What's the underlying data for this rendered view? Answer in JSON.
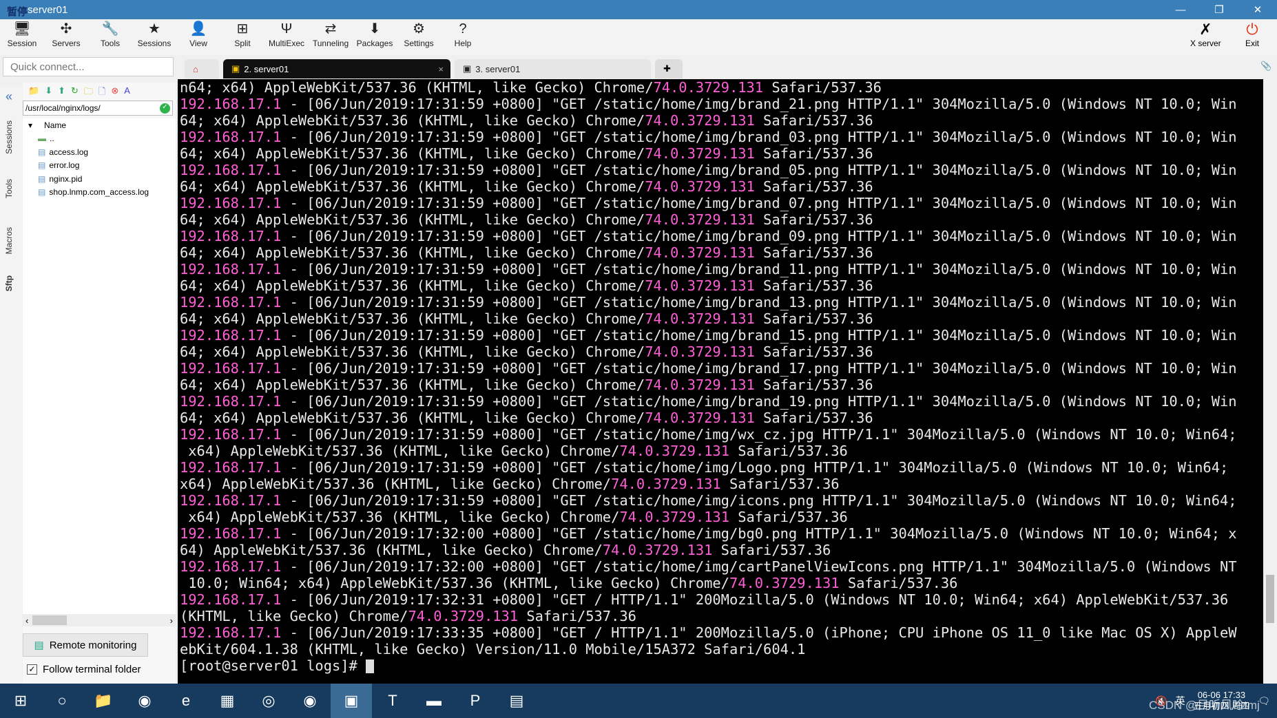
{
  "window": {
    "title": "server01",
    "overlay_label": "暂停",
    "minimize": "—",
    "restore": "❐",
    "close": "✕"
  },
  "toolbar": {
    "items": [
      {
        "label": "Session",
        "icon": "session-icon",
        "glyph": "🖥"
      },
      {
        "label": "Servers",
        "icon": "servers-icon",
        "glyph": "✣"
      },
      {
        "label": "Tools",
        "icon": "tools-icon",
        "glyph": "🔧"
      },
      {
        "label": "Sessions",
        "icon": "star-icon",
        "glyph": "★"
      },
      {
        "label": "View",
        "icon": "view-icon",
        "glyph": "👤"
      },
      {
        "label": "Split",
        "icon": "split-icon",
        "glyph": "⊞"
      },
      {
        "label": "MultiExec",
        "icon": "multiexec-icon",
        "glyph": "Ψ"
      },
      {
        "label": "Tunneling",
        "icon": "tunneling-icon",
        "glyph": "⇄"
      },
      {
        "label": "Packages",
        "icon": "packages-icon",
        "glyph": "⬇"
      },
      {
        "label": "Settings",
        "icon": "settings-icon",
        "glyph": "⚙"
      },
      {
        "label": "Help",
        "icon": "help-icon",
        "glyph": "?"
      }
    ],
    "xserver": "X server",
    "exit": "Exit"
  },
  "quick_connect": {
    "placeholder": "Quick connect..."
  },
  "tabs": [
    {
      "label": "2. server01",
      "active": true,
      "close": "×"
    },
    {
      "label": "3. server01",
      "active": false
    }
  ],
  "side_tabs": [
    "Sessions",
    "Tools",
    "Macros",
    "Sftp"
  ],
  "sftp": {
    "path": "/usr/local/nginx/logs/",
    "column": "Name",
    "files": [
      "..",
      "access.log",
      "error.log",
      "nginx.pid",
      "shop.lnmp.com_access.log"
    ],
    "remote_monitoring": "Remote monitoring",
    "follow_terminal": "Follow terminal folder",
    "follow_checked": true
  },
  "terminal": {
    "highlight_color": "#ff5fd7",
    "lines": [
      "n64; x64) AppleWebKit/537.36 (KHTML, like Gecko) Chrome/74.0.3729.131 Safari/537.36",
      "192.168.17.1 - [06/Jun/2019:17:31:59 +0800] \"GET /static/home/img/brand_21.png HTTP/1.1\" 304Mozilla/5.0 (Windows NT 10.0; Win",
      "64; x64) AppleWebKit/537.36 (KHTML, like Gecko) Chrome/74.0.3729.131 Safari/537.36",
      "192.168.17.1 - [06/Jun/2019:17:31:59 +0800] \"GET /static/home/img/brand_03.png HTTP/1.1\" 304Mozilla/5.0 (Windows NT 10.0; Win",
      "64; x64) AppleWebKit/537.36 (KHTML, like Gecko) Chrome/74.0.3729.131 Safari/537.36",
      "192.168.17.1 - [06/Jun/2019:17:31:59 +0800] \"GET /static/home/img/brand_05.png HTTP/1.1\" 304Mozilla/5.0 (Windows NT 10.0; Win",
      "64; x64) AppleWebKit/537.36 (KHTML, like Gecko) Chrome/74.0.3729.131 Safari/537.36",
      "192.168.17.1 - [06/Jun/2019:17:31:59 +0800] \"GET /static/home/img/brand_07.png HTTP/1.1\" 304Mozilla/5.0 (Windows NT 10.0; Win",
      "64; x64) AppleWebKit/537.36 (KHTML, like Gecko) Chrome/74.0.3729.131 Safari/537.36",
      "192.168.17.1 - [06/Jun/2019:17:31:59 +0800] \"GET /static/home/img/brand_09.png HTTP/1.1\" 304Mozilla/5.0 (Windows NT 10.0; Win",
      "64; x64) AppleWebKit/537.36 (KHTML, like Gecko) Chrome/74.0.3729.131 Safari/537.36",
      "192.168.17.1 - [06/Jun/2019:17:31:59 +0800] \"GET /static/home/img/brand_11.png HTTP/1.1\" 304Mozilla/5.0 (Windows NT 10.0; Win",
      "64; x64) AppleWebKit/537.36 (KHTML, like Gecko) Chrome/74.0.3729.131 Safari/537.36",
      "192.168.17.1 - [06/Jun/2019:17:31:59 +0800] \"GET /static/home/img/brand_13.png HTTP/1.1\" 304Mozilla/5.0 (Windows NT 10.0; Win",
      "64; x64) AppleWebKit/537.36 (KHTML, like Gecko) Chrome/74.0.3729.131 Safari/537.36",
      "192.168.17.1 - [06/Jun/2019:17:31:59 +0800] \"GET /static/home/img/brand_15.png HTTP/1.1\" 304Mozilla/5.0 (Windows NT 10.0; Win",
      "64; x64) AppleWebKit/537.36 (KHTML, like Gecko) Chrome/74.0.3729.131 Safari/537.36",
      "192.168.17.1 - [06/Jun/2019:17:31:59 +0800] \"GET /static/home/img/brand_17.png HTTP/1.1\" 304Mozilla/5.0 (Windows NT 10.0; Win",
      "64; x64) AppleWebKit/537.36 (KHTML, like Gecko) Chrome/74.0.3729.131 Safari/537.36",
      "192.168.17.1 - [06/Jun/2019:17:31:59 +0800] \"GET /static/home/img/brand_19.png HTTP/1.1\" 304Mozilla/5.0 (Windows NT 10.0; Win",
      "64; x64) AppleWebKit/537.36 (KHTML, like Gecko) Chrome/74.0.3729.131 Safari/537.36",
      "192.168.17.1 - [06/Jun/2019:17:31:59 +0800] \"GET /static/home/img/wx_cz.jpg HTTP/1.1\" 304Mozilla/5.0 (Windows NT 10.0; Win64;",
      " x64) AppleWebKit/537.36 (KHTML, like Gecko) Chrome/74.0.3729.131 Safari/537.36",
      "192.168.17.1 - [06/Jun/2019:17:31:59 +0800] \"GET /static/home/img/Logo.png HTTP/1.1\" 304Mozilla/5.0 (Windows NT 10.0; Win64;",
      "x64) AppleWebKit/537.36 (KHTML, like Gecko) Chrome/74.0.3729.131 Safari/537.36",
      "192.168.17.1 - [06/Jun/2019:17:31:59 +0800] \"GET /static/home/img/icons.png HTTP/1.1\" 304Mozilla/5.0 (Windows NT 10.0; Win64;",
      " x64) AppleWebKit/537.36 (KHTML, like Gecko) Chrome/74.0.3729.131 Safari/537.36",
      "192.168.17.1 - [06/Jun/2019:17:32:00 +0800] \"GET /static/home/img/bg0.png HTTP/1.1\" 304Mozilla/5.0 (Windows NT 10.0; Win64; x",
      "64) AppleWebKit/537.36 (KHTML, like Gecko) Chrome/74.0.3729.131 Safari/537.36",
      "192.168.17.1 - [06/Jun/2019:17:32:00 +0800] \"GET /static/home/img/cartPanelViewIcons.png HTTP/1.1\" 304Mozilla/5.0 (Windows NT",
      " 10.0; Win64; x64) AppleWebKit/537.36 (KHTML, like Gecko) Chrome/74.0.3729.131 Safari/537.36",
      "192.168.17.1 - [06/Jun/2019:17:32:31 +0800] \"GET / HTTP/1.1\" 200Mozilla/5.0 (Windows NT 10.0; Win64; x64) AppleWebKit/537.36",
      "(KHTML, like Gecko) Chrome/74.0.3729.131 Safari/537.36",
      "192.168.17.1 - [06/Jun/2019:17:33:35 +0800] \"GET / HTTP/1.1\" 200Mozilla/5.0 (iPhone; CPU iPhone OS 11_0 like Mac OS X) AppleW",
      "ebKit/604.1.38 (KHTML, like Gecko) Version/11.0 Mobile/15A372 Safari/604.1"
    ],
    "prompt": "[root@server01 logs]# "
  },
  "taskbar": {
    "items": [
      "start-icon",
      "search-icon",
      "file-explorer-icon",
      "app-icon",
      "edge-icon",
      "excel-icon",
      "chrome-icon",
      "app-icon",
      "mobaxterm-icon",
      "typora-icon",
      "terminal-icon",
      "pdf-icon",
      "notepad-icon"
    ],
    "ime": "英",
    "date": "06-06 17:33",
    "lunar": "五月初四 周四",
    "watermark": "CSDN @目听风吟tmj"
  }
}
